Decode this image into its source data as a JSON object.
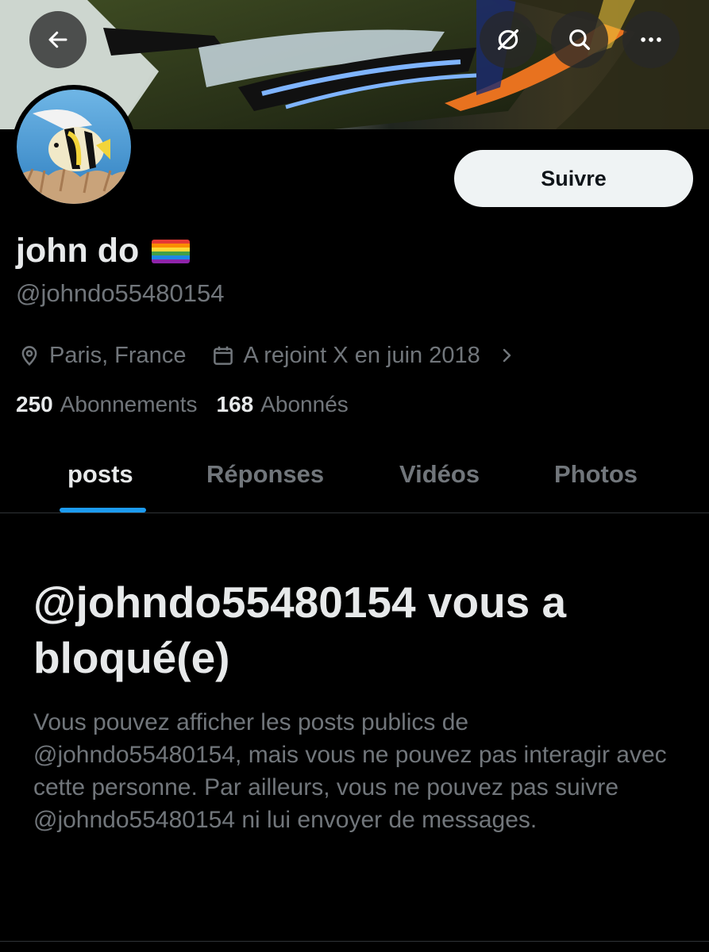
{
  "header": {
    "banner_alt": "",
    "buttons": {
      "back_icon": "arrow-left-icon",
      "grok_icon": "grok-icon",
      "search_icon": "search-icon",
      "more_icon": "more-icon"
    }
  },
  "profile": {
    "display_name": "john do",
    "name_emoji": "rainbow-flag",
    "handle": "@johndo55480154",
    "location": "Paris, France",
    "joined": "A rejoint X en juin 2018",
    "follow_label": "Suivre",
    "following_count": "250",
    "following_label": "Abonnements",
    "followers_count": "168",
    "followers_label": "Abonnés"
  },
  "tabs": [
    {
      "label": "posts",
      "active": true
    },
    {
      "label": "Réponses",
      "active": false
    },
    {
      "label": "Vidéos",
      "active": false
    },
    {
      "label": "Photos",
      "active": false
    }
  ],
  "blocked": {
    "title": "@johndo55480154 vous a bloqué(e)",
    "body": "Vous pouvez afficher les posts publics de @johndo55480154, mais vous ne pouvez pas interagir avec cette personne. Par ailleurs, vous ne pouvez pas suivre @johndo55480154 ni lui envoyer de messages."
  },
  "colors": {
    "background": "#000000",
    "text_primary": "#e7e9ea",
    "text_secondary": "#71767b",
    "accent": "#1d9bf0",
    "follow_bg": "#eff3f4"
  }
}
